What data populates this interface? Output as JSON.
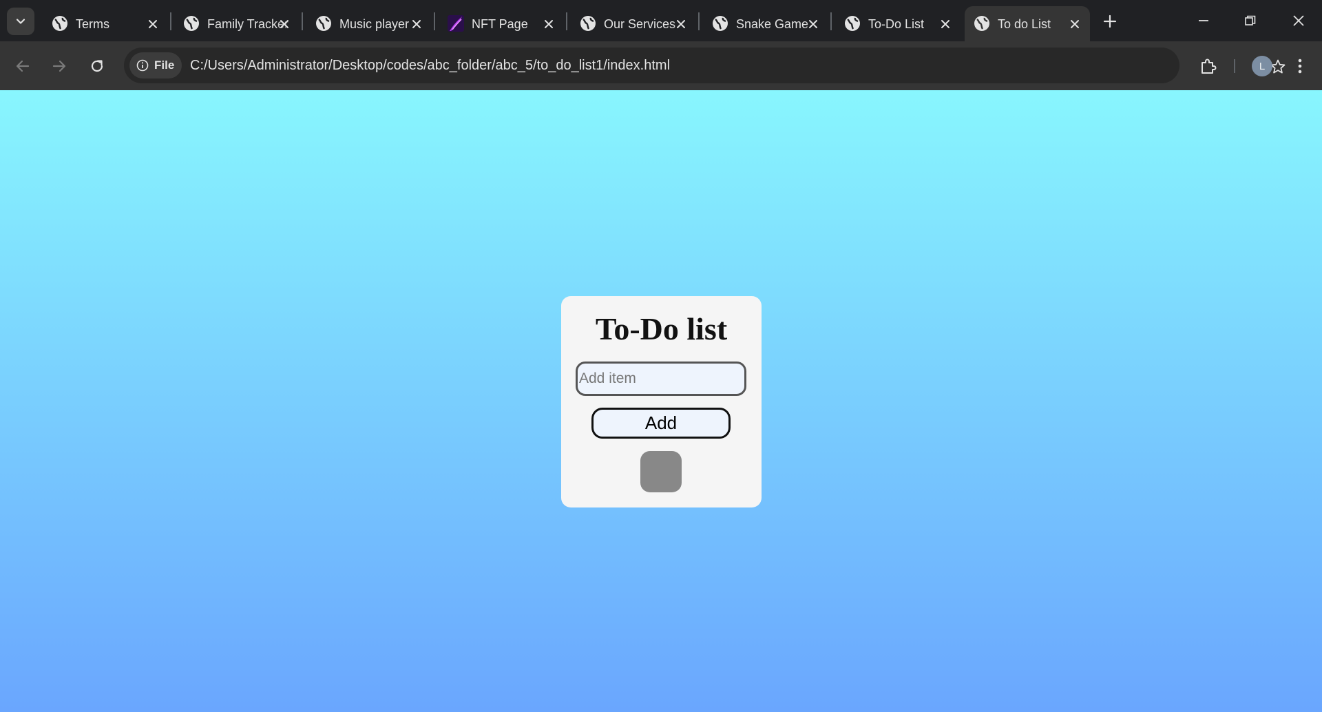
{
  "browser": {
    "tabs": [
      {
        "title": "Terms",
        "favicon": "globe-icon"
      },
      {
        "title": "Family Tracker",
        "favicon": "globe-icon"
      },
      {
        "title": "Music player",
        "favicon": "globe-icon"
      },
      {
        "title": "NFT Page",
        "favicon": "nft-logo-icon"
      },
      {
        "title": "Our Services",
        "favicon": "globe-icon"
      },
      {
        "title": "Snake Game",
        "favicon": "globe-icon"
      },
      {
        "title": "To-Do List",
        "favicon": "globe-icon"
      },
      {
        "title": "To do List",
        "favicon": "globe-icon",
        "active": true
      }
    ],
    "address_bar": {
      "chip_label": "File",
      "url": "C:/Users/Administrator/Desktop/codes/abc_folder/abc_5/to_do_list1/index.html"
    },
    "profile_initial": "L"
  },
  "page": {
    "title": "To-Do list",
    "input": {
      "placeholder": "Add item",
      "value": ""
    },
    "add_button_label": "Add",
    "items": []
  },
  "colors": {
    "gradient_top": "#88f6fe",
    "gradient_bottom": "#6aa6fe",
    "card_background": "#f5f5f5",
    "input_background": "#eef4fd",
    "list_box": "#888888"
  }
}
